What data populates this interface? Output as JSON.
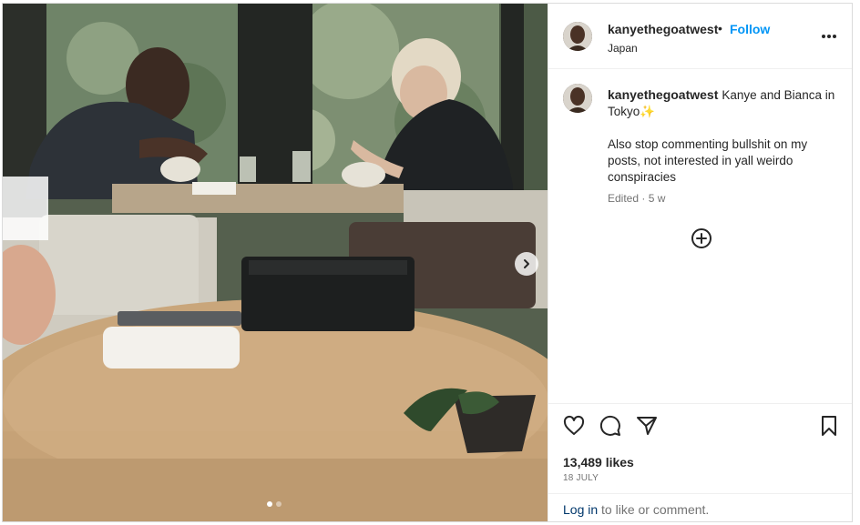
{
  "post": {
    "username": "kanyethegoatwest",
    "bullet": "•",
    "follow_label": "Follow",
    "location": "Japan",
    "more_icon": "more-horizontal-icon"
  },
  "caption": {
    "username": "kanyethegoatwest",
    "line1": "Kanye and Bianca in Tokyo✨",
    "line2": "Also stop commenting bullshit on my posts, not interested in yall weirdo conspiracies",
    "edited": "Edited · 5 w"
  },
  "actions": {
    "icons": [
      "heart-icon",
      "comment-icon",
      "share-icon",
      "bookmark-icon"
    ],
    "likes": "13,489 likes",
    "date": "18 JULY"
  },
  "login": {
    "link": "Log in",
    "rest": " to like or comment."
  },
  "carousel": {
    "current": 1,
    "total": 2
  },
  "colors": {
    "link_blue": "#0095f6",
    "login_blue": "#00376b",
    "muted": "#737373",
    "border": "#dbdbdb"
  }
}
